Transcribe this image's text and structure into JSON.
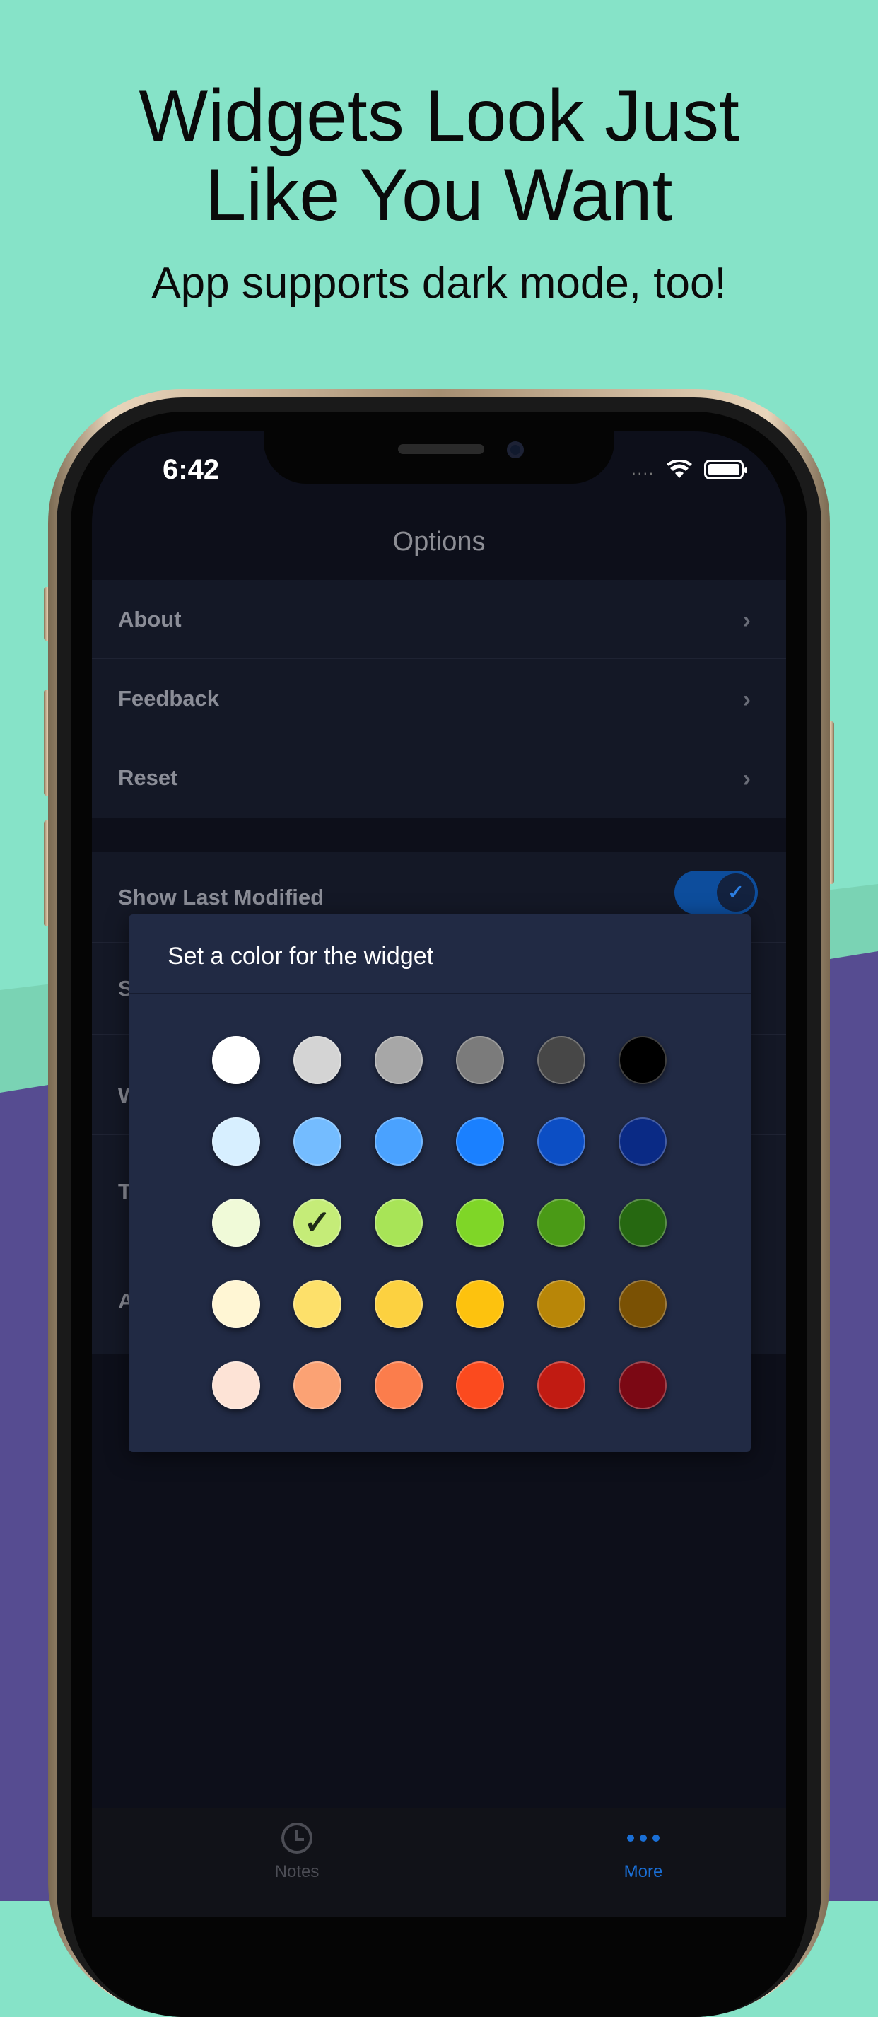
{
  "headline": {
    "line1": "Widgets Look Just",
    "line2": "Like You Want",
    "subtitle": "App supports dark mode, too!"
  },
  "status_bar": {
    "time": "6:42",
    "signal": "....",
    "wifi_icon": "wifi-icon",
    "battery_icon": "battery-icon"
  },
  "nav": {
    "title": "Options"
  },
  "menu": {
    "about": "About",
    "feedback": "Feedback",
    "reset": "Reset"
  },
  "settings": {
    "show_last_modified": "Show Last Modified",
    "show_last_modified_on": true,
    "row2_partial": "S",
    "row3_partial": "W",
    "row4_partial": "T",
    "row5_partial": "A"
  },
  "dialog": {
    "title": "Set a color for the widget",
    "selected": {
      "row": 2,
      "col": 1
    },
    "colors": [
      [
        "#ffffff",
        "#d4d4d4",
        "#a7a7a7",
        "#7b7b7b",
        "#474747",
        "#000000"
      ],
      [
        "#d7efff",
        "#74bcff",
        "#4aa2ff",
        "#1a80ff",
        "#0c4ec4",
        "#0a2a85"
      ],
      [
        "#f0fad8",
        "#c5ec78",
        "#a8e457",
        "#7fd627",
        "#4a9a16",
        "#266811"
      ],
      [
        "#fff6d4",
        "#fde06a",
        "#fcd140",
        "#fdc20e",
        "#b88608",
        "#7a5104"
      ],
      [
        "#fde3d6",
        "#fba274",
        "#fb7d4c",
        "#fb4a1e",
        "#c11b12",
        "#7b0814"
      ]
    ]
  },
  "tabbar": {
    "notes": "Notes",
    "more": "More",
    "active": "More",
    "accent": "#1a6fd6"
  }
}
